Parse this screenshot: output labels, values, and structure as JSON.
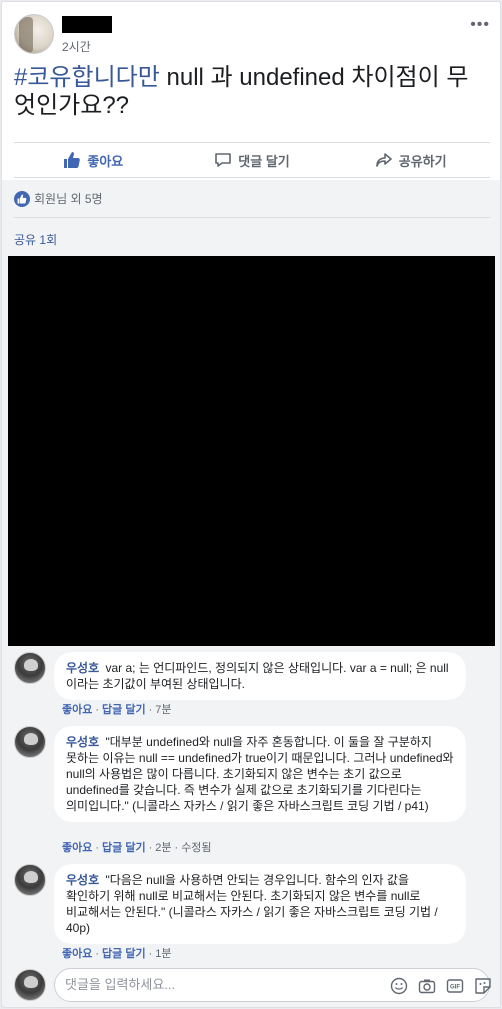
{
  "post": {
    "time": "2시간",
    "hashtag": "#코유합니다만",
    "text_rest": " null 과 undefined 차이점이 무엇인가요??",
    "more_icon": "ellipsis-icon"
  },
  "actions": {
    "like_label": "좋아요",
    "comment_label": "댓글 달기",
    "share_label": "공유하기"
  },
  "reactions": {
    "likes_text": "회원님 외 5명",
    "shares_text": "공유 1회"
  },
  "comments": [
    {
      "name": "우성호",
      "text": "var a; 는 언디파인드, 정의되지 않은 상태입니다. var a = null; 은 null 이라는 초기값이 부여된 상태입니다.",
      "like": "좋아요",
      "reply": "답글 달기",
      "time": "7분",
      "edited": ""
    },
    {
      "name": "우성호",
      "text": "\"대부분 undefined와 null을 자주 혼동합니다. 이 둘을 잘 구분하지 못하는 이유는 null == undefined가 true이기 때문입니다. 그러나 undefined와 null의 사용법은 많이 다릅니다. 초기화되지 않은 변수는 초기 값으로 undefined를 갖습니다. 즉 변수가 실제 값으로 초기화되기를 기다린다는 의미입니다.\" (니콜라스 자카스 / 읽기 좋은 자바스크립트 코딩 기법 / p41)",
      "like": "좋아요",
      "reply": "답글 달기",
      "time": "2분",
      "edited": "수정됨"
    },
    {
      "name": "우성호",
      "text": "\"다음은 null을 사용하면 안되는 경우입니다. 함수의 인자 값을 확인하기 위해 null로 비교해서는 안된다. 초기화되지 않은 변수를 null로 비교해서는 안된다.\" (니콜라스 자카스 / 읽기 좋은 자바스크립트 코딩 기법 / 40p)",
      "like": "좋아요",
      "reply": "답글 달기",
      "time": "1분",
      "edited": ""
    }
  ],
  "compose": {
    "placeholder": "댓글을 입력하세요...",
    "icons": [
      "emoji-icon",
      "camera-icon",
      "gif-icon",
      "sticker-icon"
    ]
  },
  "colors": {
    "accent": "#4267b2",
    "link": "#385898",
    "muted": "#606770"
  }
}
